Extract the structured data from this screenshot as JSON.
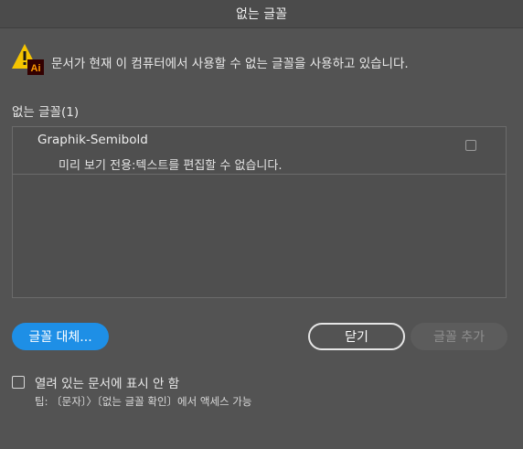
{
  "dialog": {
    "title": "없는 글꼴",
    "message": "문서가 현재 이 컴퓨터에서 사용할 수 없는 글꼴을 사용하고 있습니다.",
    "warning_icon": "warning-ai-icon",
    "app_badge": "Ai",
    "section_label": "없는 글꼴(1)",
    "fonts": [
      {
        "name": "Graphik-Semibold",
        "note": "미리 보기 전용:텍스트를 편집할 수 없습니다.",
        "checked": false
      }
    ],
    "buttons": {
      "replace": "글꼴 대체...",
      "close": "닫기",
      "add": "글꼴 추가"
    },
    "footer": {
      "checkbox_label": "열려 있는 문서에 표시 안 함",
      "tip": "팁: 〔문자〕〉〔없는 글꼴 확인〕에서 액세스 가능"
    }
  },
  "colors": {
    "background": "#535353",
    "accent": "#1e8fe6",
    "warning": "#f5c400",
    "ai_badge": "#330000",
    "ai_text": "#ff9a00"
  }
}
